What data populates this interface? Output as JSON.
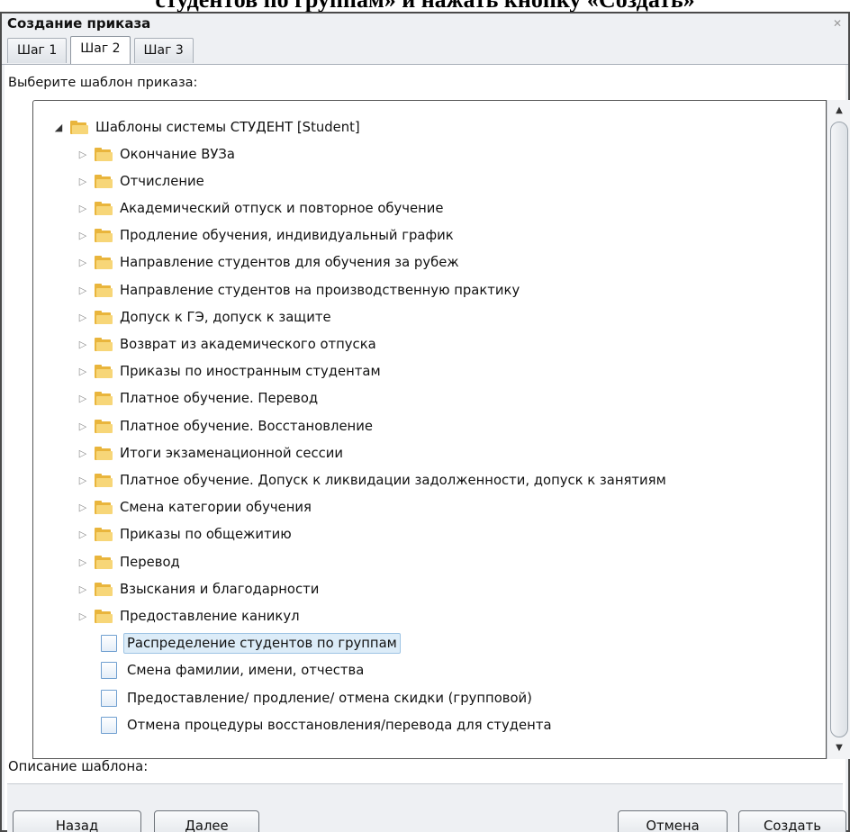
{
  "document_text": "студентов по группам» и нажать кнопку «Создать»",
  "window": {
    "title": "Создание приказа"
  },
  "tabs": [
    {
      "label": "Шаг 1",
      "active": false
    },
    {
      "label": "Шаг 2",
      "active": true
    },
    {
      "label": "Шаг 3",
      "active": false
    }
  ],
  "prompt_label": "Выберите шаблон приказа:",
  "tree": {
    "root": {
      "label": "Шаблоны системы СТУДЕНТ [Student]",
      "expanded": true,
      "icon": "folder-icon"
    },
    "folders": [
      "Окончание ВУЗа",
      "Отчисление",
      "Академический отпуск и повторное обучение",
      "Продление обучения, индивидуальный график",
      "Направление студентов для обучения за рубеж",
      "Направление студентов на производственную практику",
      "Допуск к ГЭ, допуск к защите",
      "Возврат из академического отпуска",
      "Приказы по иностранным студентам",
      "Платное обучение. Перевод",
      "Платное обучение. Восстановление",
      "Итоги экзаменационной сессии",
      "Платное обучение. Допуск к ликвидации задолженности, допуск к занятиям",
      "Смена категории обучения",
      "Приказы по общежитию",
      "Перевод",
      "Взыскания и благодарности",
      "Предоставление каникул"
    ],
    "documents": [
      {
        "label": "Распределение студентов по группам",
        "selected": true
      },
      {
        "label": "Смена фамилии, имени, отчества",
        "selected": false
      },
      {
        "label": "Предоставление/ продление/ отмена скидки (групповой)",
        "selected": false
      },
      {
        "label": "Отмена процедуры восстановления/перевода для студента",
        "selected": false
      }
    ]
  },
  "description_label": "Описание шаблона:",
  "buttons": {
    "back": "Назад",
    "next": "Далее",
    "cancel": "Отмена",
    "create": "Создать"
  },
  "colors": {
    "folder": "#e9b53c",
    "selection": "#dcecf8",
    "dialog_bg": "#eef0f3"
  }
}
